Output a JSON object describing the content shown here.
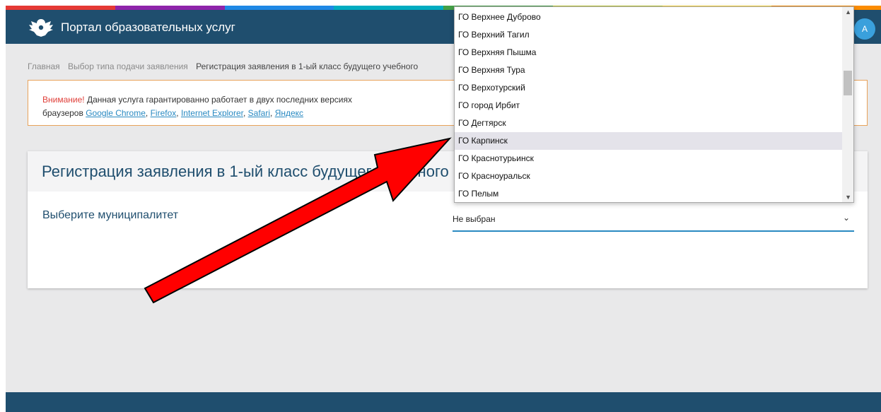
{
  "colors": {
    "header_bg": "#1f4e6e",
    "accent": "#2a8ac2",
    "warning_border": "#e8a25a",
    "warning_text": "#e0403a",
    "arrow_fill": "#ff0000",
    "strip": [
      "#e53935",
      "#8e24aa",
      "#1e88e5",
      "#00acc1",
      "#43a047",
      "#c0ca33",
      "#fdd835",
      "#fb8c00"
    ]
  },
  "header": {
    "logo_icon": "coat-of-arms-icon",
    "title": "Портал образовательных услуг",
    "login_label": "А"
  },
  "breadcrumb": {
    "items": [
      "Главная",
      "Выбор типа подачи заявления",
      "Регистрация заявления в 1-ый класс будущего учебного"
    ]
  },
  "warning": {
    "attention": "Внимание!",
    "text1": " Данная услуга гарантированно работает в двух последних версиях",
    "text2": "браузеров ",
    "links": [
      "Google Chrome",
      "Firefox",
      "Internet Explorer",
      "Safari",
      "Яндекс"
    ],
    "sep": ", "
  },
  "card": {
    "title": "Регистрация заявления в 1-ый класс будущего учебного года",
    "field_label": "Выберите муниципалитет",
    "select_value": "Не выбран"
  },
  "dropdown": {
    "options": [
      "ГО Верхнее Дуброво",
      "ГО Верхний Тагил",
      "ГО Верхняя Пышма",
      "ГО Верхняя Тура",
      "ГО Верхотурский",
      "ГО город Ирбит",
      "ГО Дегтярск",
      "ГО Карпинск",
      "ГО Краснотурьинск",
      "ГО Красноуральск",
      "ГО Пелым"
    ],
    "selected_index": 7
  }
}
